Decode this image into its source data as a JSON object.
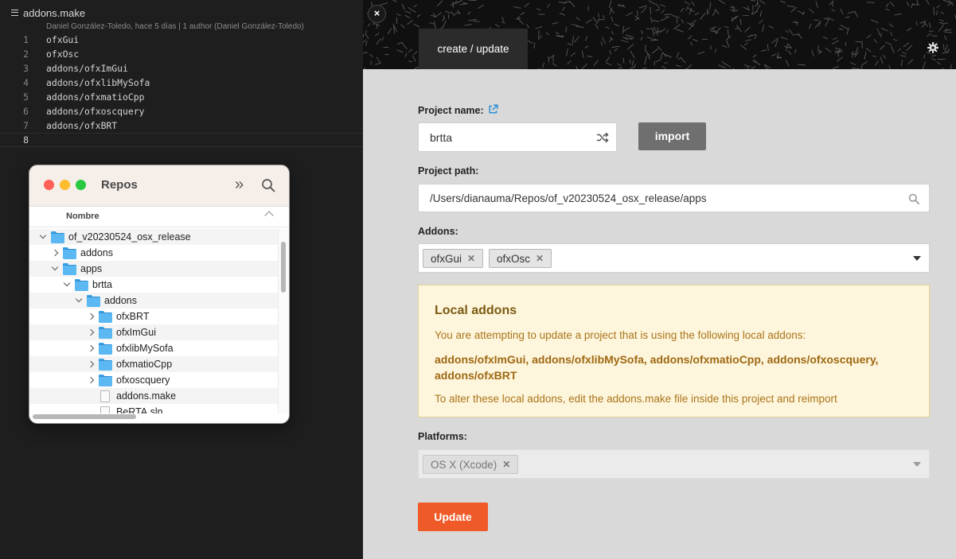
{
  "editor": {
    "filename": "addons.make",
    "blame": "Daniel González-Toledo, hace 5 días | 1 author (Daniel González-Toledo)",
    "lines": [
      {
        "n": "1",
        "text": "ofxGui"
      },
      {
        "n": "2",
        "text": "ofxOsc"
      },
      {
        "n": "3",
        "text": "addons/ofxImGui"
      },
      {
        "n": "4",
        "text": "addons/ofxlibMySofa"
      },
      {
        "n": "5",
        "text": "addons/ofxmatioCpp"
      },
      {
        "n": "6",
        "text": "addons/ofxoscquery"
      },
      {
        "n": "7",
        "text": "addons/ofxBRT"
      },
      {
        "n": "8",
        "text": ""
      }
    ]
  },
  "finder": {
    "title": "Repos",
    "column_header": "Nombre",
    "rows": [
      {
        "label": "of_v20230524_osx_release",
        "kind": "folder",
        "expanded": true,
        "depth": 0
      },
      {
        "label": "addons",
        "kind": "folder",
        "expanded": false,
        "depth": 1
      },
      {
        "label": "apps",
        "kind": "folder",
        "expanded": true,
        "depth": 1
      },
      {
        "label": "brtta",
        "kind": "folder",
        "expanded": true,
        "depth": 2
      },
      {
        "label": "addons",
        "kind": "folder",
        "expanded": true,
        "depth": 3
      },
      {
        "label": "ofxBRT",
        "kind": "folder",
        "expanded": false,
        "depth": 4
      },
      {
        "label": "ofxImGui",
        "kind": "folder",
        "expanded": false,
        "depth": 4
      },
      {
        "label": "ofxlibMySofa",
        "kind": "folder",
        "expanded": false,
        "depth": 4
      },
      {
        "label": "ofxmatioCpp",
        "kind": "folder",
        "expanded": false,
        "depth": 4
      },
      {
        "label": "ofxoscquery",
        "kind": "folder",
        "expanded": false,
        "depth": 4
      },
      {
        "label": "addons.make",
        "kind": "file",
        "depth": 4
      },
      {
        "label": "BeRTA.sln",
        "kind": "file",
        "depth": 4
      }
    ]
  },
  "pg": {
    "close": "×",
    "tab": "create / update",
    "project_name_label": "Project name:",
    "project_name_value": "brtta",
    "import_label": "import",
    "project_path_label": "Project path:",
    "project_path_value": "/Users/dianauma/Repos/of_v20230524_osx_release/apps",
    "addons_label": "Addons:",
    "addons": [
      "ofxGui",
      "ofxOsc"
    ],
    "local_addons": {
      "title": "Local addons",
      "description": "You are attempting to update a project that is using the following local addons:",
      "list": "addons/ofxImGui, addons/ofxlibMySofa, addons/ofxmatioCpp, addons/ofxoscquery, addons/ofxBRT",
      "footer": "To alter these local addons, edit the addons.make file inside this project and reimport"
    },
    "platforms_label": "Platforms:",
    "platforms": [
      "OS X (Xcode)"
    ],
    "update_label": "Update"
  },
  "colors": {
    "accent": "#f05a28",
    "warning_bg": "#fef6dc",
    "warning_text": "#a9741b"
  }
}
